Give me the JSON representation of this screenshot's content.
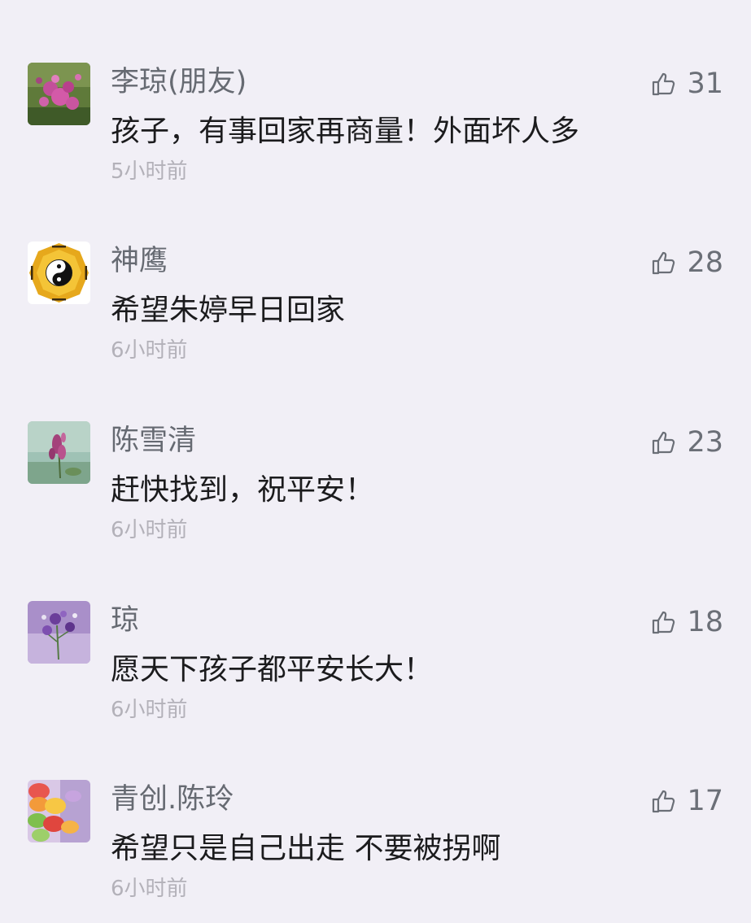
{
  "comments": [
    {
      "name": "李琼(朋友)",
      "text": "孩子，有事回家再商量！外面坏人多",
      "time": "5小时前",
      "likes": "31",
      "avatar_icon": "pink-flowers-photo"
    },
    {
      "name": "神鹰",
      "text": "希望朱婷早日回家",
      "time": "6小时前",
      "likes": "28",
      "avatar_icon": "yin-yang-bagua-icon"
    },
    {
      "name": "陈雪清",
      "text": "赶快找到，祝平安！",
      "time": "6小时前",
      "likes": "23",
      "avatar_icon": "purple-flower-photo"
    },
    {
      "name": "琼",
      "text": "愿天下孩子都平安长大！",
      "time": "6小时前",
      "likes": "18",
      "avatar_icon": "violet-flowers-photo"
    },
    {
      "name": "青创.陈玲",
      "text": "希望只是自己出走 不要被拐啊",
      "time": "6小时前",
      "likes": "17",
      "avatar_icon": "macarons-photo"
    }
  ],
  "colors": {
    "background": "#f1eff6",
    "name": "#666a72",
    "text": "#1b1b1d",
    "time": "#b3b1b9",
    "like": "#6b6f77"
  }
}
